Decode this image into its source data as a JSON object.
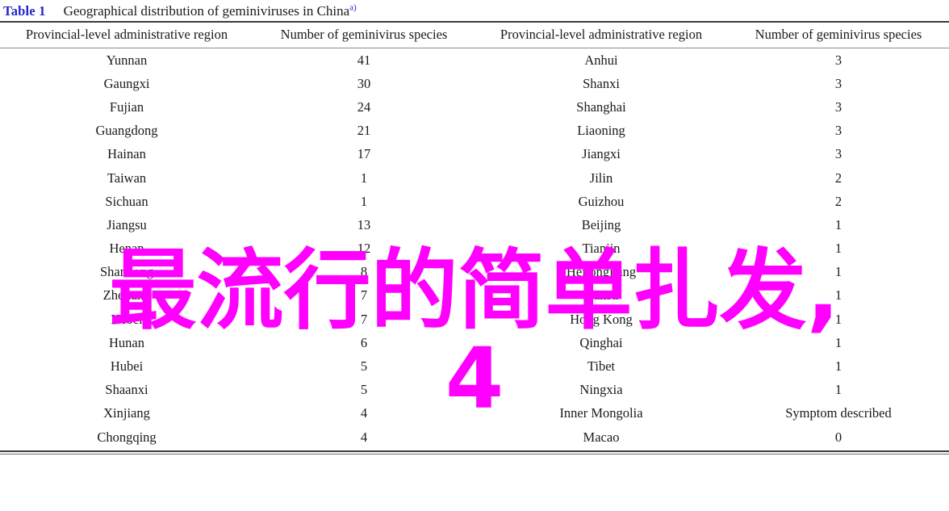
{
  "caption": {
    "label": "Table 1",
    "text": "Geographical distribution of geminiviruses in China",
    "footnote_marker": "a)",
    "label_color": "#2222cc"
  },
  "table": {
    "headers": [
      "Provincial-level administrative region",
      "Number of geminivirus species",
      "Provincial-level administrative region",
      "Number of geminivirus species"
    ],
    "rows": [
      {
        "region_left": "Yunnan",
        "count_left": "41",
        "region_right": "Anhui",
        "count_right": "3"
      },
      {
        "region_left": "Gaungxi",
        "count_left": "30",
        "region_right": "Shanxi",
        "count_right": "3"
      },
      {
        "region_left": "Fujian",
        "count_left": "24",
        "region_right": "Shanghai",
        "count_right": "3"
      },
      {
        "region_left": "Guangdong",
        "count_left": "21",
        "region_right": "Liaoning",
        "count_right": "3"
      },
      {
        "region_left": "Hainan",
        "count_left": "17",
        "region_right": "Jiangxi",
        "count_right": "3"
      },
      {
        "region_left": "Taiwan",
        "count_left": "1",
        "region_right": "Jilin",
        "count_right": "2"
      },
      {
        "region_left": "Sichuan",
        "count_left": "1",
        "region_right": "Guizhou",
        "count_right": "2"
      },
      {
        "region_left": "Jiangsu",
        "count_left": "13",
        "region_right": "Beijing",
        "count_right": "1"
      },
      {
        "region_left": "Henan",
        "count_left": "12",
        "region_right": "Tianjin",
        "count_right": "1"
      },
      {
        "region_left": "Shandong",
        "count_left": "8",
        "region_right": "Heilongjiang",
        "count_right": "1"
      },
      {
        "region_left": "Zhejiang",
        "count_left": "7",
        "region_right": "Gansu",
        "count_right": "1"
      },
      {
        "region_left": "Hebei",
        "count_left": "7",
        "region_right": "Hong Kong",
        "count_right": "1"
      },
      {
        "region_left": "Hunan",
        "count_left": "6",
        "region_right": "Qinghai",
        "count_right": "1"
      },
      {
        "region_left": "Hubei",
        "count_left": "5",
        "region_right": "Tibet",
        "count_right": "1"
      },
      {
        "region_left": "Shaanxi",
        "count_left": "5",
        "region_right": "Ningxia",
        "count_right": "1"
      },
      {
        "region_left": "Xinjiang",
        "count_left": "4",
        "region_right": "Inner Mongolia",
        "count_right": "Symptom described"
      },
      {
        "region_left": "Chongqing",
        "count_left": "4",
        "region_right": "Macao",
        "count_right": "0"
      }
    ]
  },
  "watermark": {
    "line1": "最流行的简单扎发,",
    "line2": "4",
    "color": "#ff00ff"
  }
}
